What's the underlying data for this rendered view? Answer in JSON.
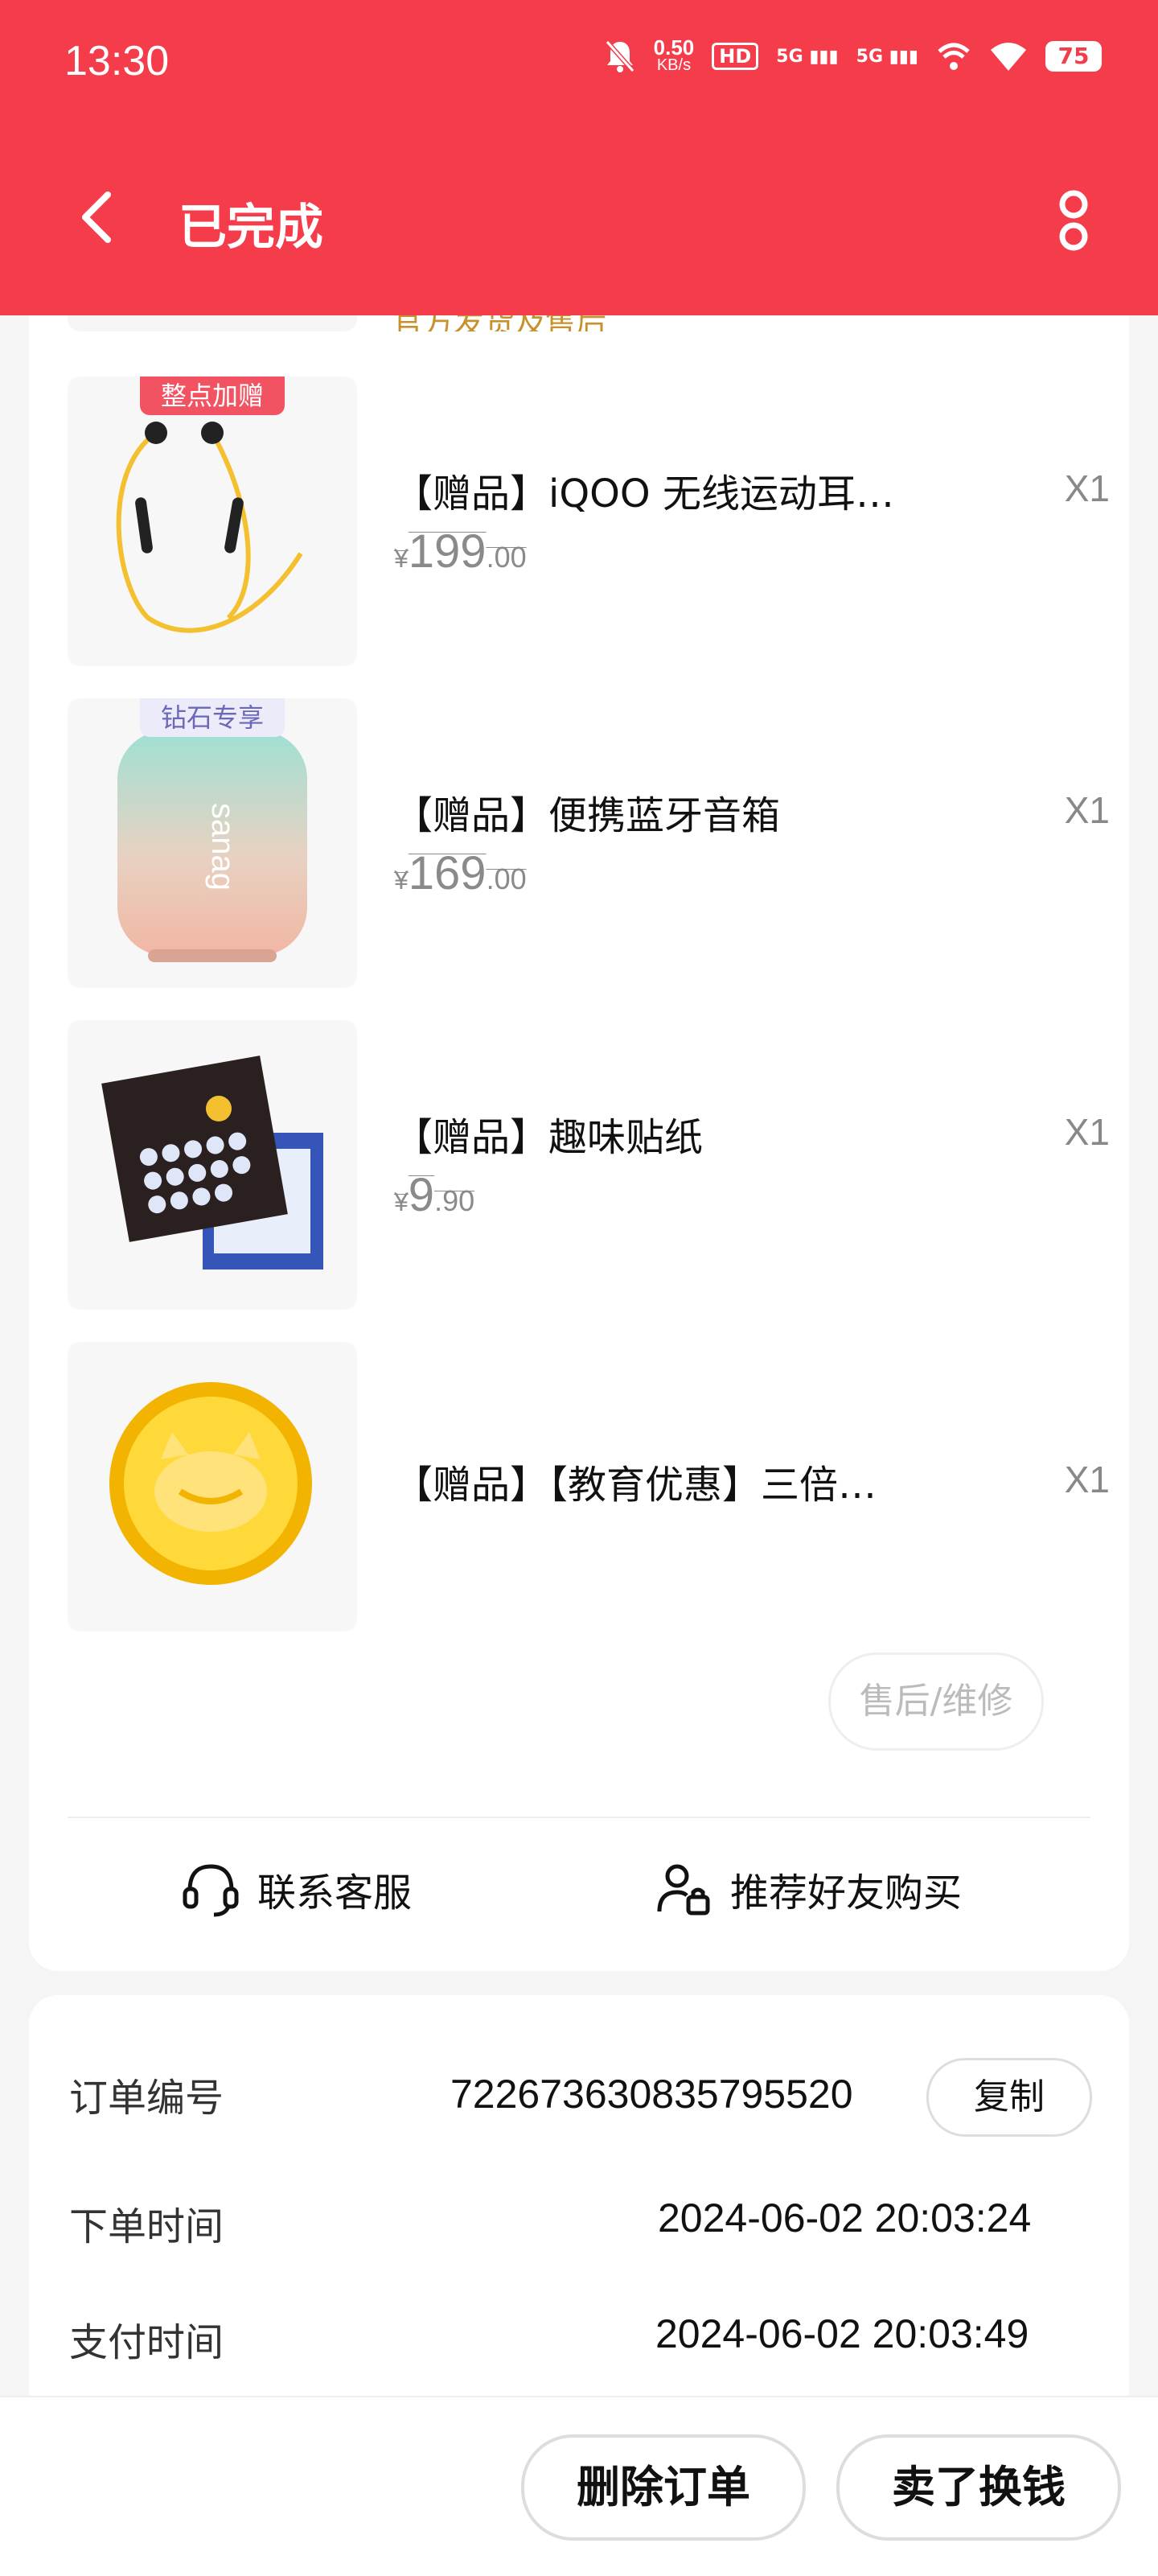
{
  "status_bar": {
    "time": "13:30",
    "net_speed_value": "0.50",
    "net_speed_unit": "KB/s",
    "hd_label": "HD",
    "signal_1": "5G",
    "signal_2": "5G",
    "battery": "75"
  },
  "nav": {
    "title": "已完成"
  },
  "previous_item_tag": "官方发货及售后",
  "items": [
    {
      "badge": "整点加赠",
      "name": "【赠品】iQOO 无线运动耳…",
      "qty": "X1",
      "price_int": "199",
      "price_dec": ".00",
      "currency": "¥"
    },
    {
      "badge": "钻石专享",
      "name": "【赠品】便携蓝牙音箱",
      "qty": "X1",
      "price_int": "169",
      "price_dec": ".00",
      "currency": "¥"
    },
    {
      "badge": "",
      "name": "【赠品】趣味贴纸",
      "qty": "X1",
      "price_int": "9",
      "price_dec": ".90",
      "currency": "¥"
    },
    {
      "badge": "",
      "name": "【赠品】【教育优惠】三倍…",
      "qty": "X1"
    }
  ],
  "speaker_print": "sanag",
  "after_sales_button": "售后/维修",
  "actions": {
    "contact": "联系客服",
    "recommend": "推荐好友购买"
  },
  "order_info": {
    "order_no_label": "订单编号",
    "order_no": "722673630835795520",
    "copy_button": "复制",
    "order_time_label": "下单时间",
    "order_time": "2024-06-02 20:03:24",
    "pay_time_label": "支付时间",
    "pay_time": "2024-06-02 20:03:49"
  },
  "bottom_bar": {
    "delete_button": "删除订单",
    "sell_button": "卖了换钱"
  },
  "colors": {
    "brand_red": "#f53c4b",
    "badge_red": "#f25362",
    "badge_purple_text": "#6b68b6"
  }
}
